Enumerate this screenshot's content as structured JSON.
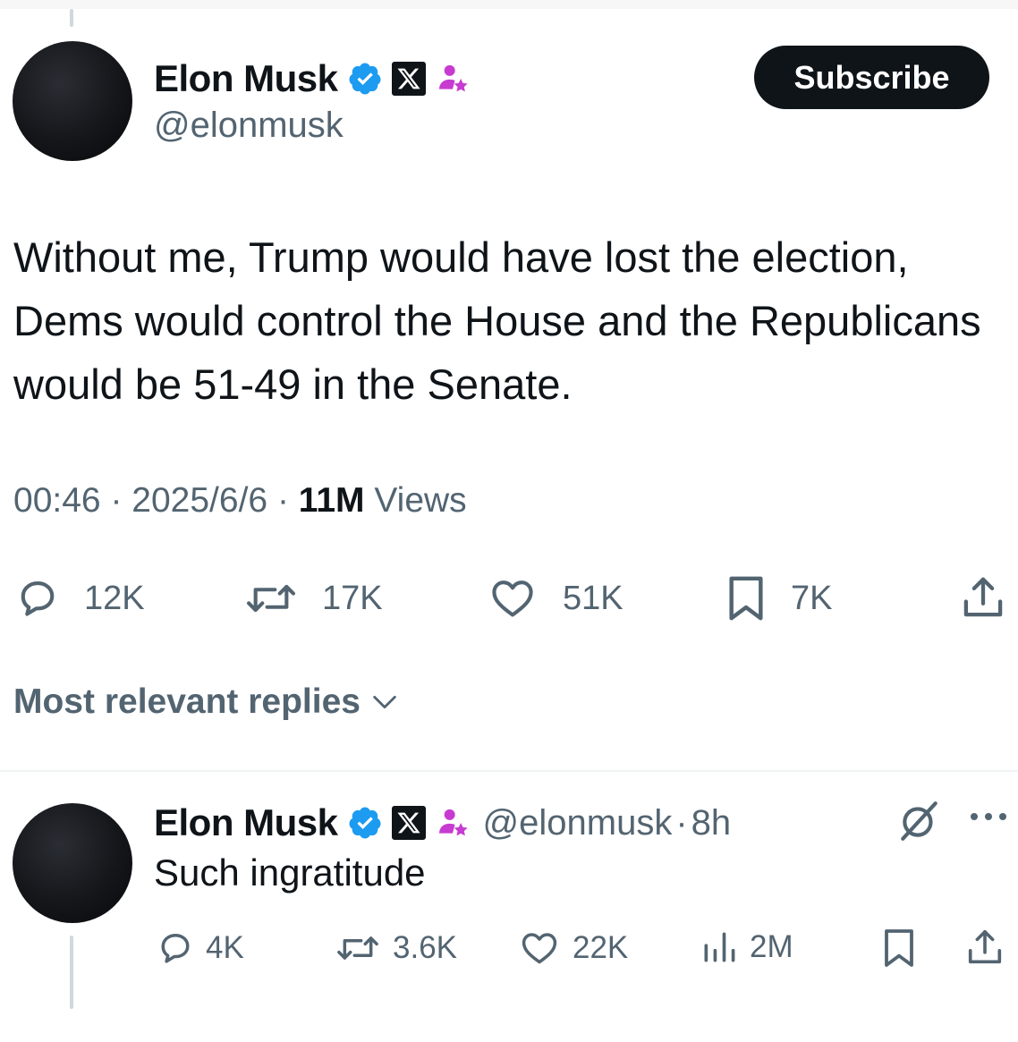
{
  "colors": {
    "text_primary": "#0f1419",
    "text_secondary": "#536471",
    "verified_blue": "#1d9bf0",
    "affiliate_pink": "#c73bd1",
    "button_bg": "#0f1419"
  },
  "tweet": {
    "author": {
      "name": "Elon Musk",
      "handle": "@elonmusk",
      "badges": [
        "verified-icon",
        "x-logo-icon",
        "affiliate-person-icon"
      ]
    },
    "subscribe_label": "Subscribe",
    "text": "Without me, Trump would have lost the election, Dems would control the House and the Republicans would be 51-49 in the Senate.",
    "time": "00:46",
    "date": "2025/6/6",
    "separator": "·",
    "views_count": "11M",
    "views_label": "Views",
    "actions": {
      "replies": "12K",
      "reposts": "17K",
      "likes": "51K",
      "bookmarks": "7K"
    }
  },
  "replies_header": {
    "label": "Most relevant replies",
    "icon": "chevron-down-icon"
  },
  "reply": {
    "author": {
      "name": "Elon Musk",
      "handle": "@elonmusk",
      "time_ago": "8h",
      "separator": "·"
    },
    "text": "Such ingratitude",
    "actions": {
      "replies": "4K",
      "reposts": "3.6K",
      "likes": "22K",
      "views": "2M"
    }
  }
}
